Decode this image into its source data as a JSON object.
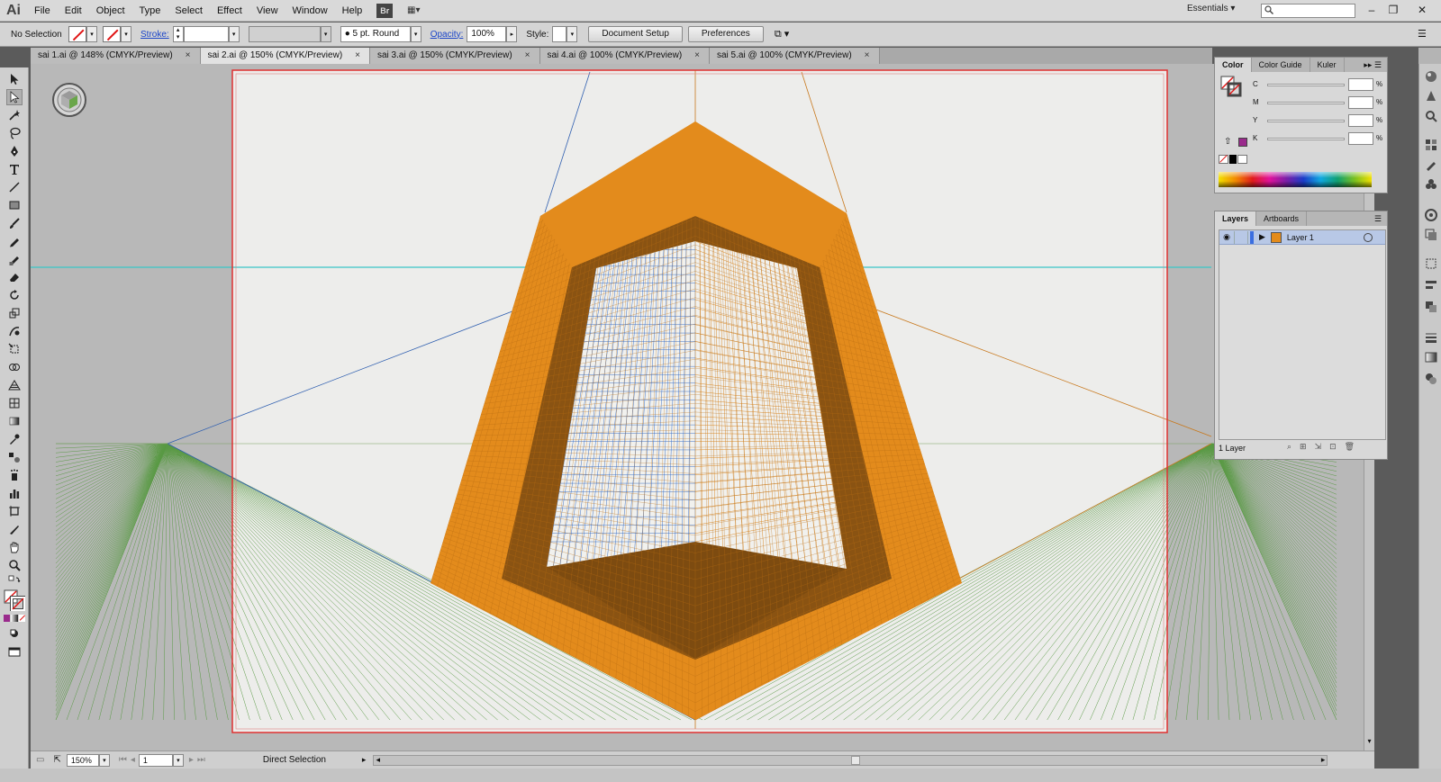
{
  "app": {
    "logo": "Ai"
  },
  "menu": [
    "File",
    "Edit",
    "Object",
    "Type",
    "Select",
    "Effect",
    "View",
    "Window",
    "Help"
  ],
  "menubar_extras": {
    "bridge": "Br",
    "arrange": "▦▾",
    "workspace": "Essentials ▾",
    "search_placeholder": ""
  },
  "window_controls": {
    "minimize": "–",
    "restore": "❐",
    "close": "✕"
  },
  "control": {
    "selection": "No Selection",
    "stroke_label": "Stroke:",
    "stroke_value": "",
    "brush": "● 5 pt. Round",
    "opacity_label": "Opacity:",
    "opacity_value": "100%",
    "style_label": "Style:",
    "document_setup": "Document Setup",
    "preferences": "Preferences"
  },
  "tabs": [
    {
      "label": "sai 1.ai @ 148% (CMYK/Preview)"
    },
    {
      "label": "sai 2.ai @ 150% (CMYK/Preview)"
    },
    {
      "label": "sai 3.ai @ 150% (CMYK/Preview)"
    },
    {
      "label": "sai 4.ai @ 100% (CMYK/Preview)"
    },
    {
      "label": "sai 5.ai @ 100% (CMYK/Preview)"
    }
  ],
  "tab_close": "×",
  "status": {
    "zoom": "150%",
    "artboard": "1",
    "tool": "Direct Selection"
  },
  "color_panel": {
    "tabs": [
      "Color",
      "Color Guide",
      "Kuler"
    ],
    "channels": [
      {
        "letter": "C",
        "value": ""
      },
      {
        "letter": "M",
        "value": ""
      },
      {
        "letter": "Y",
        "value": ""
      },
      {
        "letter": "K",
        "value": ""
      }
    ],
    "percent": "%"
  },
  "layers_panel": {
    "tabs": [
      "Layers",
      "Artboards"
    ],
    "layer_name": "Layer 1",
    "count": "1 Layer"
  },
  "colors": {
    "orange": "#e38b1c",
    "orange_dark": "#8a5312",
    "grid_blue": "#3f73c8",
    "grid_orange": "#d98a2a",
    "grid_green": "#4e8a3a",
    "horizon": "#39c6c6",
    "artboard_border": "#e03030"
  }
}
